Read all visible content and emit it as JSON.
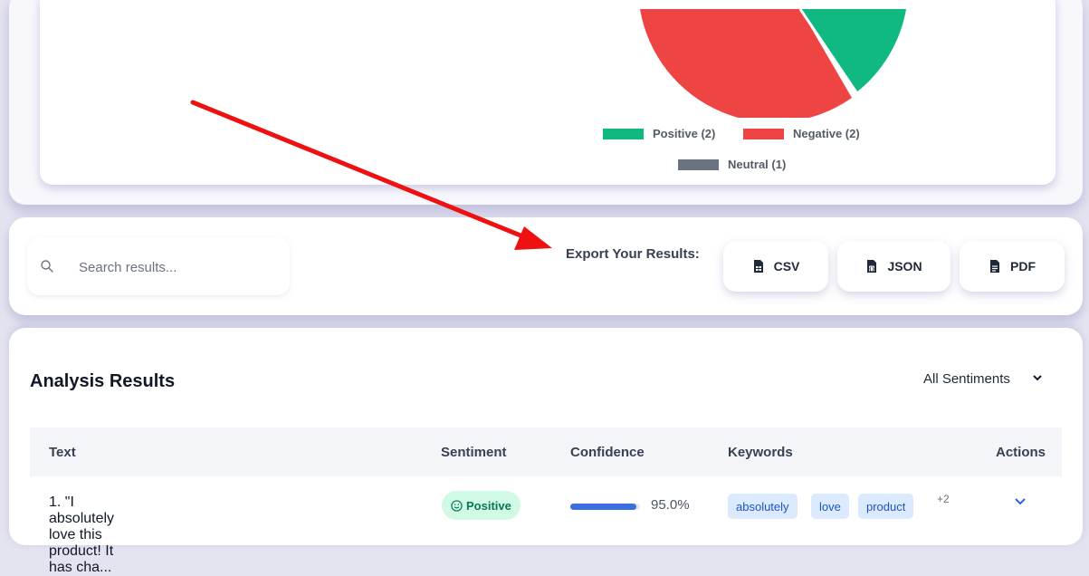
{
  "chart": {
    "legend": [
      {
        "label": "Positive (2)",
        "color": "#10b981"
      },
      {
        "label": "Negative (2)",
        "color": "#ef4444"
      },
      {
        "label": "Neutral (1)",
        "color": "#6b7280"
      }
    ]
  },
  "toolbar": {
    "search_placeholder": "Search results...",
    "export_label": "Export Your Results:",
    "buttons": [
      {
        "label": "CSV",
        "icon": "file-csv-icon"
      },
      {
        "label": "JSON",
        "icon": "file-json-icon"
      },
      {
        "label": "PDF",
        "icon": "file-pdf-icon"
      }
    ]
  },
  "results": {
    "title": "Analysis Results",
    "filter_value": "All Sentiments",
    "columns": [
      "Text",
      "Sentiment",
      "Confidence",
      "Keywords",
      "Actions"
    ],
    "rows": [
      {
        "text": "1. \"I absolutely love this product! It has cha...",
        "sentiment": "Positive",
        "confidence": "95.0%",
        "confidence_fraction": 0.95,
        "keywords": [
          "absolutely",
          "love",
          "product"
        ],
        "more_keywords": "+2"
      }
    ]
  },
  "colors": {
    "positive": "#10b981",
    "negative": "#ef4444",
    "neutral": "#6b7280",
    "accent": "#3b6fe0",
    "annotation_arrow": "#ee1111"
  }
}
